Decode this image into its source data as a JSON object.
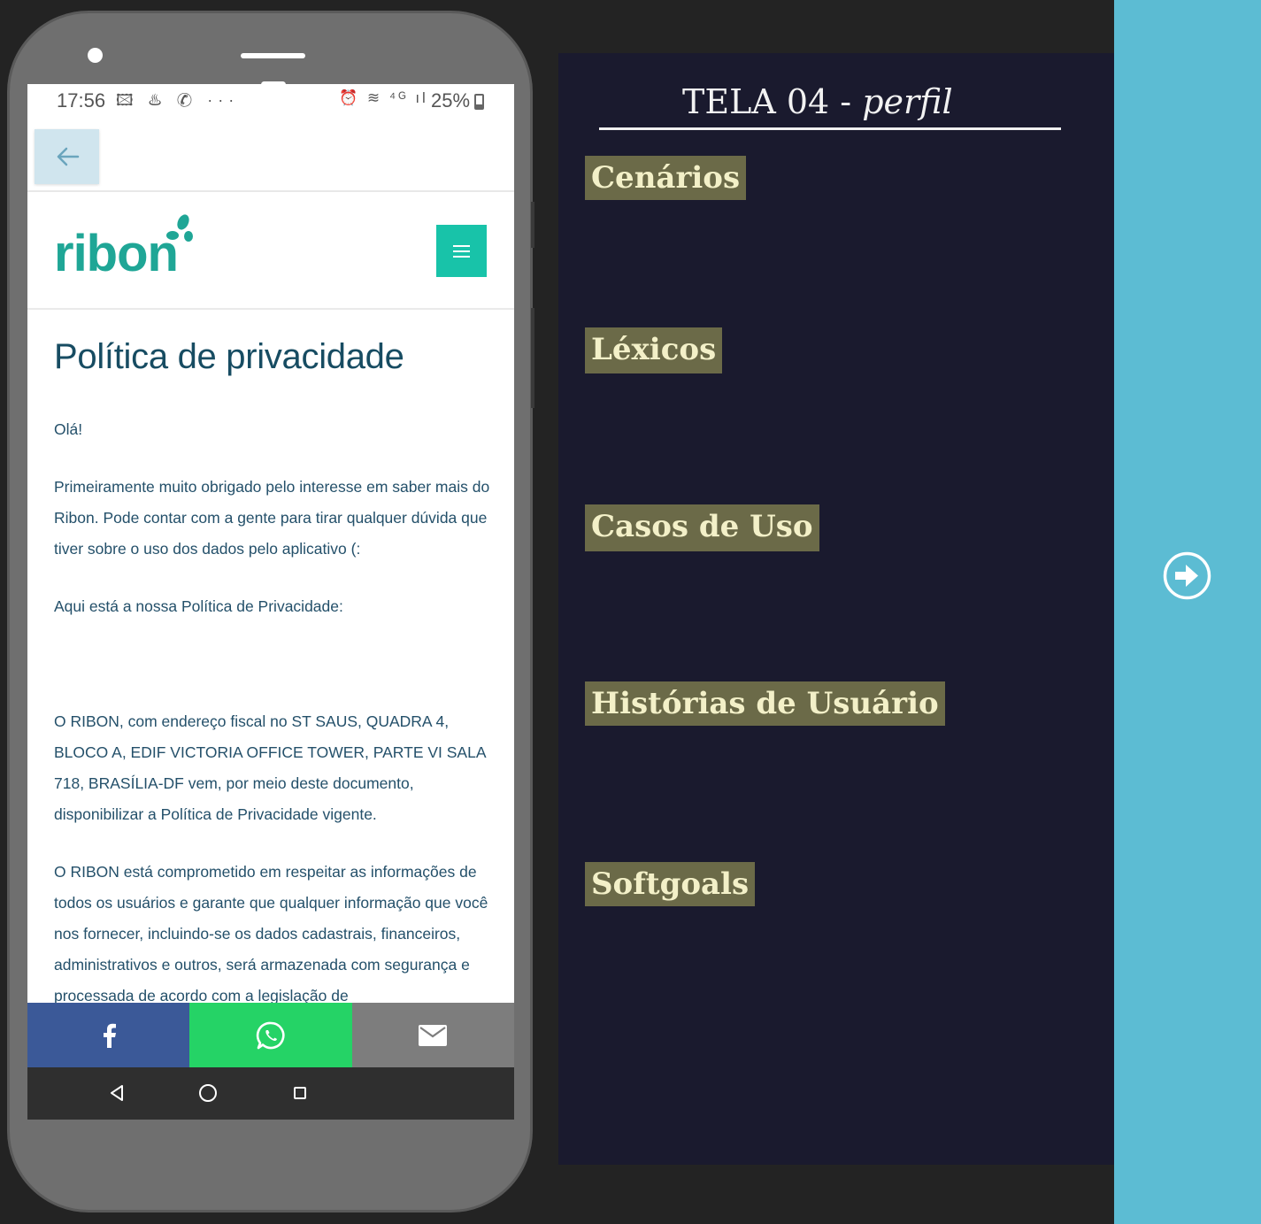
{
  "status": {
    "time": "17:56",
    "icons_left": "🖾 ♨ ✆ ···",
    "icons_right": "⏰ ≋ ⁴ᴳ ıl",
    "battery": "25%"
  },
  "site": {
    "logo": "ribon"
  },
  "article": {
    "title": "Política de privacidade",
    "hello": "Olá!",
    "p1": "Primeiramente muito obrigado pelo interesse em saber mais do Ribon. Pode contar com a gente para tirar qualquer dúvida que tiver sobre o uso dos dados pelo aplicativo (:",
    "p2": "Aqui está a nossa Política de Privacidade:",
    "p3": "O RIBON, com endereço fiscal no ST SAUS, QUADRA 4, BLOCO A, EDIF VICTORIA OFFICE TOWER, PARTE VI SALA 718, BRASÍLIA-DF vem, por meio deste documento, disponibilizar a Política de Privacidade vigente.",
    "p4": "O RIBON está comprometido em respeitar as informações de todos os usuários e garante que qualquer informação que você nos fornecer, incluindo-se os dados cadastrais, financeiros, administrativos e outros, será armazenada com segurança e processada de acordo com a legislação de"
  },
  "share": {
    "facebook_icon": "facebook-icon",
    "whatsapp_icon": "whatsapp-icon",
    "mail_icon": "mail-icon"
  },
  "panel": {
    "title_main": "TELA 04 - ",
    "title_sub": "perfil",
    "tags": [
      "Cenários",
      "Léxicos",
      "Casos de Uso",
      "Histórias de Usuário",
      "Softgoals"
    ]
  },
  "colors": {
    "accent": "#5cbcd3",
    "panel_bg": "#1a1a2e",
    "tag_bg": "#6b6a48",
    "ribon_green": "#1fa696",
    "facebook": "#3b5998",
    "whatsapp": "#25d366"
  }
}
